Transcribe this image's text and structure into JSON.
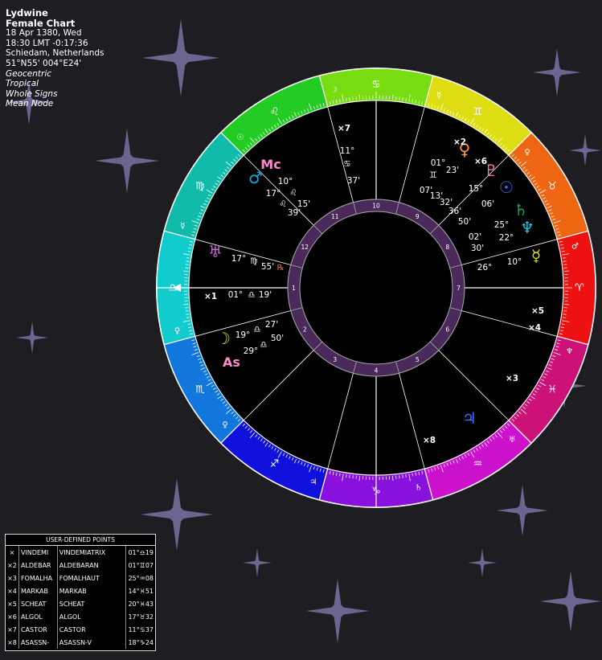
{
  "header": {
    "name": "Lydwine",
    "chart_type": "Female Chart",
    "date": "18 Apr 1380, Wed",
    "time": "18:30  LMT -0:17:36",
    "place": "Schiedam, Netherlands",
    "coords": "51°N55' 004°E24'",
    "options": [
      "Geocentric",
      "Tropical",
      "Whole Signs",
      "Mean Node"
    ]
  },
  "colors": {
    "background": "#1e1e22",
    "star": "#6a6690",
    "house_ring": "#4a2a5a",
    "zodiac": [
      "#ee1111",
      "#cc1177",
      "#cc11cc",
      "#8811dd",
      "#1111dd",
      "#1177dd",
      "#11cccc",
      "#11bbaa",
      "#22cc22",
      "#77dd11",
      "#dddd11",
      "#ee8811"
    ]
  },
  "zodiac_signs": [
    {
      "glyph": "♈",
      "ruler": "♂"
    },
    {
      "glyph": "♓",
      "ruler": "♆"
    },
    {
      "glyph": "♒",
      "ruler": "♅"
    },
    {
      "glyph": "♑",
      "ruler": "♄"
    },
    {
      "glyph": "♐",
      "ruler": "♃"
    },
    {
      "glyph": "♏",
      "ruler": "♀"
    },
    {
      "glyph": "♎",
      "ruler": "♀"
    },
    {
      "glyph": "♍",
      "ruler": "☿"
    },
    {
      "glyph": "♌",
      "ruler": "☉"
    },
    {
      "glyph": "♋",
      "ruler": "☽"
    },
    {
      "glyph": "♊",
      "ruler": "☿"
    },
    {
      "glyph": "♉",
      "ruler": "♀"
    }
  ],
  "houses": [
    "1",
    "2",
    "3",
    "4",
    "5",
    "6",
    "7",
    "8",
    "9",
    "10",
    "11",
    "12"
  ],
  "planets": [
    {
      "name": "Sun",
      "glyph": "☉",
      "color": "#3a6cff",
      "deg": "15°",
      "sign": "♉",
      "min": "06'"
    },
    {
      "name": "Moon",
      "glyph": "☽",
      "color": "#dddd11",
      "deg": "19°",
      "sign": "♎",
      "min": "27'"
    },
    {
      "name": "Mercury",
      "glyph": "☿",
      "color": "#dddd11",
      "deg": "26°",
      "sign": "♈",
      "min": "10°"
    },
    {
      "name": "Venus",
      "glyph": "♀",
      "color": "#ff9933",
      "deg": "01°",
      "sign": "♊",
      "min": "23'"
    },
    {
      "name": "Mars",
      "glyph": "♂",
      "color": "#11aadd",
      "deg": "10°",
      "sign": "♌",
      "min": "17°"
    },
    {
      "name": "Jupiter",
      "glyph": "♃",
      "color": "#3a6cff",
      "deg": "18°",
      "sign": "♑",
      "min": "24'"
    },
    {
      "name": "Saturn",
      "glyph": "♄",
      "color": "#11aa44",
      "deg": "25°",
      "sign": "♈",
      "min": "02'"
    },
    {
      "name": "Uranus",
      "glyph": "♅",
      "color": "#cc66dd",
      "deg": "17°",
      "sign": "♍",
      "min": "55'"
    },
    {
      "name": "Neptune",
      "glyph": "♆",
      "color": "#11ccdd",
      "deg": "22°",
      "sign": "♈",
      "min": "30'"
    },
    {
      "name": "Pluto",
      "glyph": "♇",
      "color": "#ff77aa",
      "deg": "17°",
      "sign": "♉",
      "min": "13'"
    },
    {
      "name": "Ascendant",
      "glyph": "As",
      "color": "#ff88cc",
      "deg": "29°",
      "sign": "♎",
      "min": "50'"
    },
    {
      "name": "Midheaven",
      "glyph": "Mc",
      "color": "#ff88cc",
      "deg": "15'",
      "sign": "♌",
      "min": "39'"
    }
  ],
  "retrograde": "℞",
  "cusp_labels": {
    "h7": {
      "deg": "11°",
      "sign": "♋",
      "min": "37'"
    },
    "asc_line": {
      "deg": "01°",
      "sign": "♎",
      "min": "19'"
    },
    "taurus_group": [
      "07'",
      "32'",
      "36'",
      "50'"
    ]
  },
  "fixed_star_markers": [
    "×1",
    "×2",
    "×3",
    "×4",
    "×5",
    "×6",
    "×7",
    "×8"
  ],
  "user_points": {
    "title": "USER-DEFINED POINTS",
    "rows": [
      {
        "mark": "×",
        "short": "VINDEMI",
        "name": "VINDEMIATRIX",
        "pos": "01°♎19"
      },
      {
        "mark": "×2",
        "short": "ALDEBAR",
        "name": "ALDEBARAN",
        "pos": "01°♊07"
      },
      {
        "mark": "×3",
        "short": "FOMALHA",
        "name": "FOMALHAUT",
        "pos": "25°♒08"
      },
      {
        "mark": "×4",
        "short": "MARKAB",
        "name": "MARKAB",
        "pos": "14°♓51"
      },
      {
        "mark": "×5",
        "short": "SCHEAT",
        "name": "SCHEAT",
        "pos": "20°♓43"
      },
      {
        "mark": "×6",
        "short": "ALGOL",
        "name": "ALGOL",
        "pos": "17°♉32"
      },
      {
        "mark": "×7",
        "short": "CASTOR",
        "name": "CASTOR",
        "pos": "11°♋37"
      },
      {
        "mark": "×8",
        "short": "ASASSN-",
        "name": "ASASSN-V",
        "pos": "18°♑24"
      }
    ]
  }
}
